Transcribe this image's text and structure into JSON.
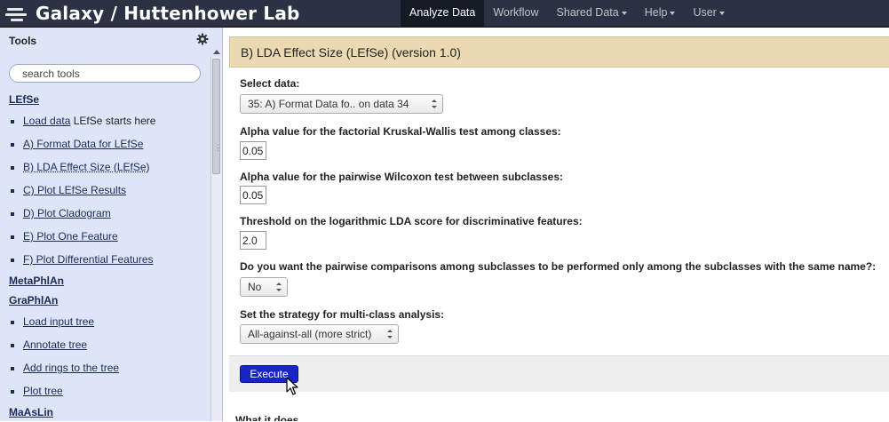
{
  "masthead": {
    "title": "Galaxy / Huttenhower Lab",
    "nav": [
      {
        "label": "Analyze Data",
        "active": true,
        "dropdown": false
      },
      {
        "label": "Workflow",
        "active": false,
        "dropdown": false
      },
      {
        "label": "Shared Data",
        "active": false,
        "dropdown": true
      },
      {
        "label": "Help",
        "active": false,
        "dropdown": true
      },
      {
        "label": "User",
        "active": false,
        "dropdown": true
      }
    ]
  },
  "tools": {
    "title": "Tools",
    "search_placeholder": "search tools",
    "sections": [
      {
        "label": "LEfSe"
      },
      {
        "label": "MetaPhlAn"
      },
      {
        "label": "GraPhlAn"
      },
      {
        "label": "MaAsLin"
      }
    ],
    "lefse_items": [
      {
        "link": "Load data",
        "suffix": " LEfSe starts here"
      },
      {
        "link": "A) Format Data for LEfSe",
        "suffix": ""
      },
      {
        "link": "B) LDA Effect Size (LEfSe)",
        "suffix": ""
      },
      {
        "link": "C) Plot LEfSe Results",
        "suffix": ""
      },
      {
        "link": "D) Plot Cladogram",
        "suffix": ""
      },
      {
        "link": "E) Plot One Feature",
        "suffix": ""
      },
      {
        "link": "F) Plot Differential Features",
        "suffix": ""
      }
    ],
    "graphlan_items": [
      {
        "link": "Load input tree"
      },
      {
        "link": "Annotate tree"
      },
      {
        "link": "Add rings to the tree"
      },
      {
        "link": "Plot tree"
      }
    ]
  },
  "form": {
    "title": "B) LDA Effect Size (LEfSe) (version 1.0)",
    "select_data_label": "Select data:",
    "select_data_value": "35: A) Format Data fo.. on data 34",
    "alpha_kw_label": "Alpha value for the factorial Kruskal-Wallis test among classes:",
    "alpha_kw_value": "0.05",
    "alpha_wilcoxon_label": "Alpha value for the pairwise Wilcoxon test between subclasses:",
    "alpha_wilcoxon_value": "0.05",
    "lda_threshold_label": "Threshold on the logarithmic LDA score for discriminative features:",
    "lda_threshold_value": "2.0",
    "same_name_label": "Do you want the pairwise comparisons among subclasses to be performed only among the subclasses with the same name?:",
    "same_name_value": "No",
    "strategy_label": "Set the strategy for multi-class analysis:",
    "strategy_value": "All-against-all (more strict)",
    "execute_label": "Execute",
    "what_it_does": "What it does"
  },
  "colors": {
    "masthead_bg": "#2c3143",
    "tool_panel_bg": "#dfe5f9",
    "form_header_bg": "#ebd9b2",
    "execute_bg": "#1725c6"
  }
}
